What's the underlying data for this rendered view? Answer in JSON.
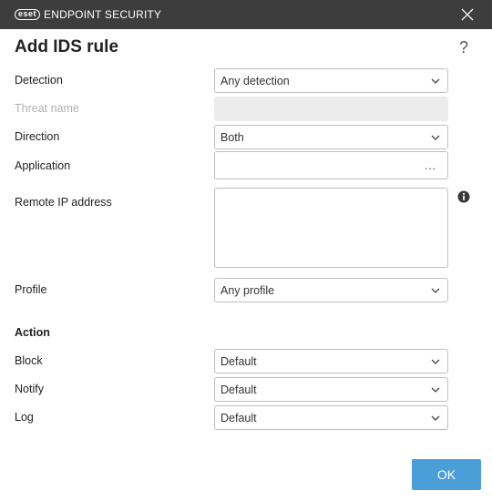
{
  "app": {
    "brand_badge": "eset",
    "brand_name": "ENDPOINT SECURITY"
  },
  "dialog": {
    "title": "Add IDS rule",
    "help": "?"
  },
  "form": {
    "detection": {
      "label": "Detection",
      "value": "Any detection"
    },
    "threat_name": {
      "label": "Threat name",
      "value": ""
    },
    "direction": {
      "label": "Direction",
      "value": "Both"
    },
    "application": {
      "label": "Application",
      "value": "",
      "browse": "..."
    },
    "remote_ip": {
      "label": "Remote IP address",
      "value": ""
    },
    "profile": {
      "label": "Profile",
      "value": "Any profile"
    }
  },
  "action": {
    "heading": "Action",
    "block": {
      "label": "Block",
      "value": "Default"
    },
    "notify": {
      "label": "Notify",
      "value": "Default"
    },
    "log": {
      "label": "Log",
      "value": "Default"
    }
  },
  "buttons": {
    "ok": "OK"
  },
  "colors": {
    "titlebar": "#3d3d3d",
    "accent": "#4a9fd8"
  },
  "icons": [
    "close-icon",
    "help-icon",
    "chevron-down-icon",
    "info-icon"
  ]
}
